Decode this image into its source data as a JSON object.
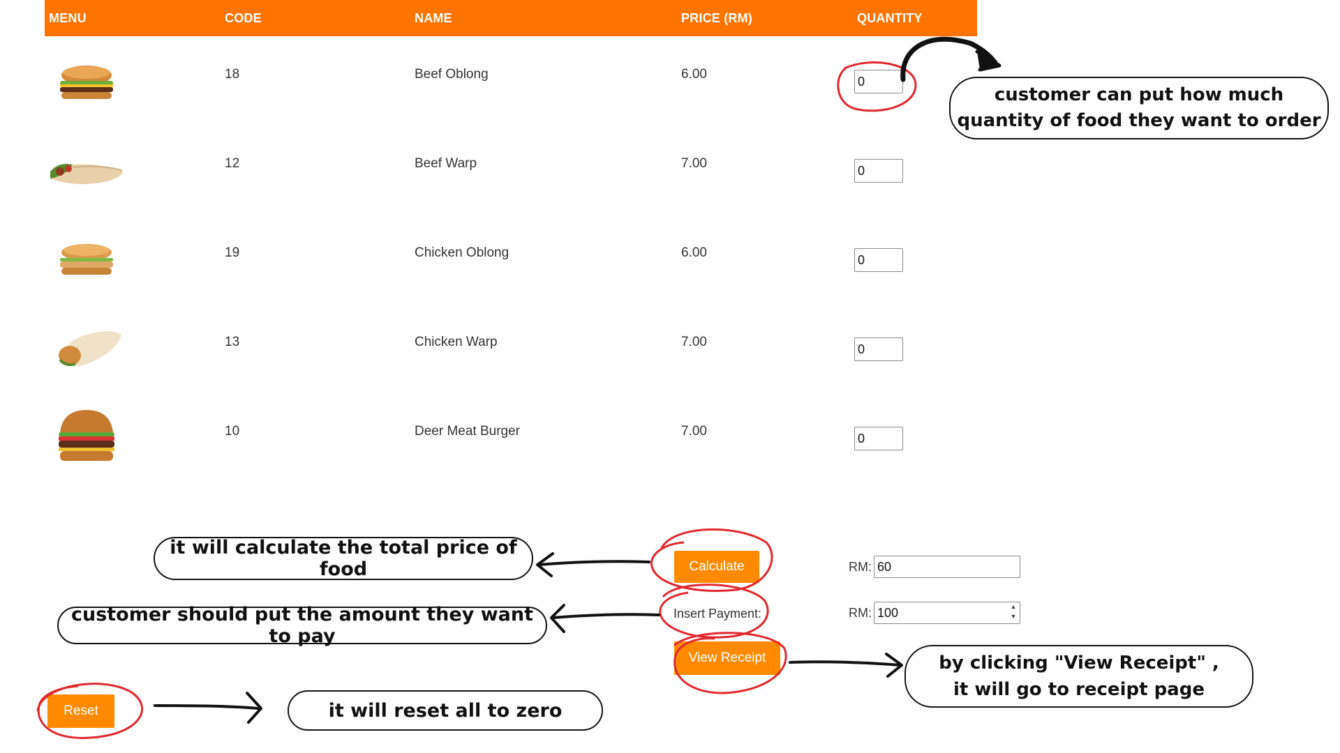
{
  "table": {
    "headers": {
      "menu": "MENU",
      "code": "CODE",
      "name": "NAME",
      "price": "PRICE (RM)",
      "quantity": "QUANTITY"
    },
    "rows": [
      {
        "code": "18",
        "name": "Beef Oblong",
        "price": "6.00",
        "qty": "0",
        "image": "burger-oblong-beef"
      },
      {
        "code": "12",
        "name": "Beef Warp",
        "price": "7.00",
        "qty": "0",
        "image": "wrap-beef"
      },
      {
        "code": "19",
        "name": "Chicken Oblong",
        "price": "6.00",
        "qty": "0",
        "image": "burger-oblong-chicken"
      },
      {
        "code": "13",
        "name": "Chicken Warp",
        "price": "7.00",
        "qty": "0",
        "image": "wrap-chicken"
      },
      {
        "code": "10",
        "name": "Deer Meat Burger",
        "price": "7.00",
        "qty": "0",
        "image": "burger-deer"
      }
    ]
  },
  "actions": {
    "calculate_label": "Calculate",
    "insert_payment_label": "Insert Payment:",
    "view_receipt_label": "View Receipt",
    "reset_label": "Reset"
  },
  "totals": {
    "total_prefix": "RM:",
    "total_value": "60",
    "payment_prefix": "RM:",
    "payment_value": "100"
  },
  "annotations": {
    "quantity_note_line1": "customer can put how much",
    "quantity_note_line2": "quantity of food they want to order",
    "calculate_note": "it will calculate the total price of food",
    "payment_note": "customer should put the amount they want to pay",
    "receipt_note_line1": "by clicking \"View Receipt\" ,",
    "receipt_note_line2": "it will go to receipt page",
    "reset_note": "it will reset all to zero"
  },
  "colors": {
    "header": "#ff7300",
    "button": "#ff8a00",
    "highlight_circle": "#e0282e"
  }
}
